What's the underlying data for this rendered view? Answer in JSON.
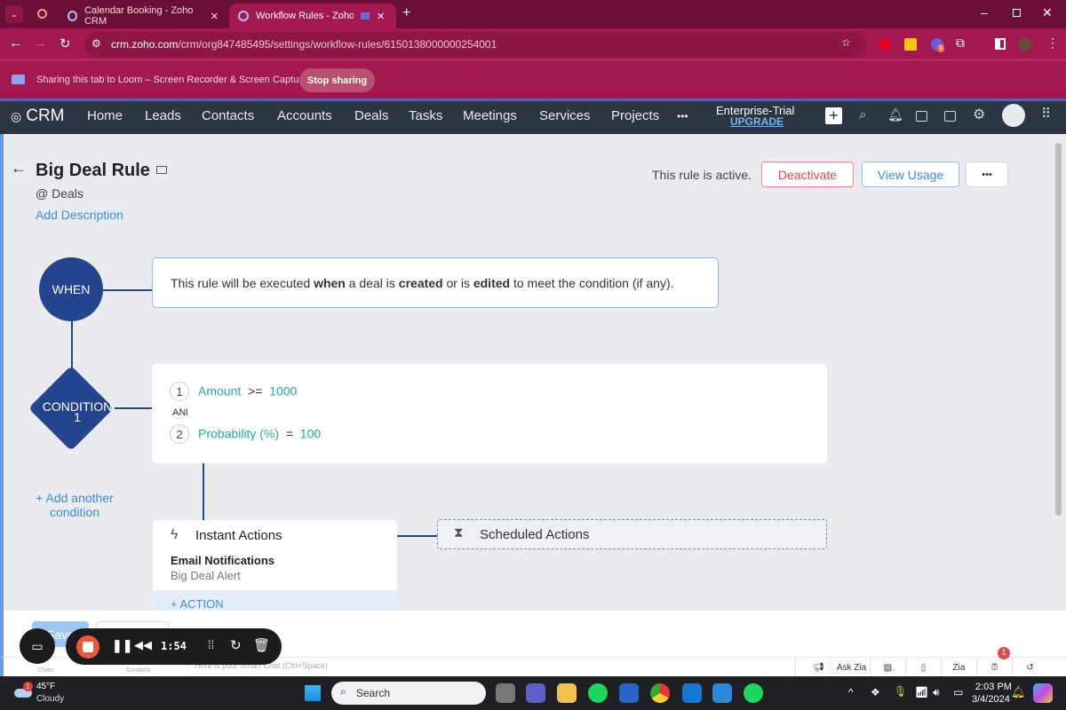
{
  "browser": {
    "tabs": [
      {
        "title": "Calendar Booking - Zoho CRM"
      },
      {
        "title": "Workflow Rules - Zoho CRM"
      }
    ],
    "url_host": "crm.zoho.com",
    "url_path": "/crm/org847485495/settings/workflow-rules/6150138000000254001",
    "extension_badge": "9"
  },
  "loom_bar": {
    "message": "Sharing this tab to Loom – Screen Recorder & Screen Capture",
    "stop_label": "Stop sharing"
  },
  "crm_nav": {
    "logo": "CRM",
    "items": [
      "Home",
      "Leads",
      "Contacts",
      "Accounts",
      "Deals",
      "Tasks",
      "Meetings",
      "Services",
      "Projects"
    ],
    "more": "•••",
    "plan": "Enterprise-Trial",
    "upgrade": "UPGRADE"
  },
  "rule": {
    "title": "Big Deal Rule",
    "module_prefix": "@",
    "module": "Deals",
    "add_description": "Add Description",
    "status_text": "This rule is active.",
    "deactivate": "Deactivate",
    "view_usage": "View Usage",
    "more": "•••"
  },
  "when": {
    "label": "WHEN",
    "pre": "This rule will be executed ",
    "w1": "when",
    "m1": " a deal is ",
    "w2": "created",
    "m2": " or is ",
    "w3": "edited",
    "post": " to meet the condition (if any)."
  },
  "condition": {
    "label": "CONDITION",
    "number": "1",
    "criteria": [
      {
        "n": "1",
        "field": "Amount",
        "op": ">=",
        "value": "1000"
      },
      {
        "n": "2",
        "field": "Probability (%)",
        "op": "=",
        "value": "100"
      }
    ],
    "joiner": "AND",
    "add_another": "+ Add another condition"
  },
  "actions": {
    "instant_title": "Instant Actions",
    "type": "Email Notifications",
    "name": "Big Deal Alert",
    "add_action": "+ ACTION",
    "scheduled_title": "Scheduled Actions"
  },
  "footer": {
    "save": "Save"
  },
  "zoho_bar": {
    "chats": "Chats",
    "contacts": "Contacts",
    "smart_chat": "Here is your Smart Chat (Ctrl+Space)",
    "ask_zia": "Ask Zia",
    "alarm_badge": "1"
  },
  "loom": {
    "timer": "1:54"
  },
  "taskbar": {
    "weather_temp": "45°F",
    "weather_desc": "Cloudy",
    "weather_badge": "1",
    "search": "Search",
    "time": "2:03 PM",
    "date": "3/4/2024"
  },
  "colors": {
    "brand_dark": "#24448e",
    "teal": "#1fae9a",
    "link": "#3b8de0",
    "danger": "#e5484d",
    "browser": "#a3184f"
  }
}
